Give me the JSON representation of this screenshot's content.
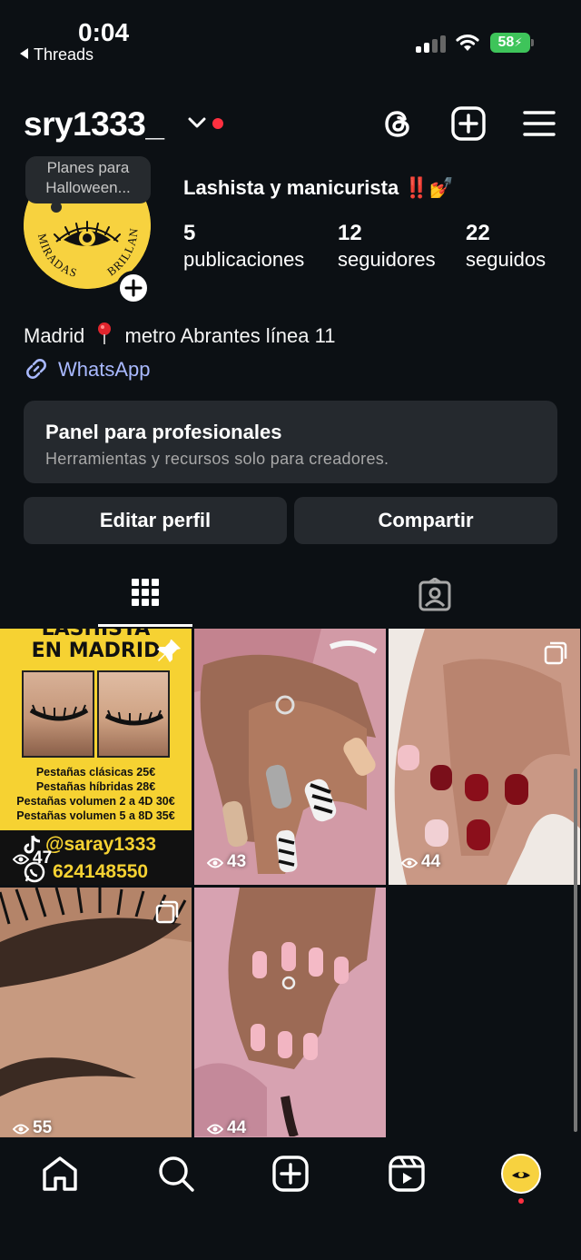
{
  "status_bar": {
    "time": "0:04",
    "back_app": "Threads",
    "battery": "58"
  },
  "header": {
    "username": "sry1333_"
  },
  "profile": {
    "note": "Planes para Halloween...",
    "bio_title": "Lashista y manicurista",
    "bio_emojis": "‼️💅",
    "stats": [
      {
        "value": "5",
        "label": "publicaciones"
      },
      {
        "value": "12",
        "label": "seguidores"
      },
      {
        "value": "22",
        "label": "seguidos"
      }
    ],
    "location_prefix": "Madrid",
    "location_suffix": "metro Abrantes línea 11",
    "link_label": "WhatsApp",
    "avatar_text": "MIRADAS QUE BRILLAN"
  },
  "panel": {
    "title": "Panel para profesionales",
    "subtitle": "Herramientas y recursos solo para creadores."
  },
  "buttons": {
    "edit": "Editar perfil",
    "share": "Compartir"
  },
  "posts": [
    {
      "views": "47",
      "pinned": true,
      "heading": "LASHISTA",
      "heading2": "EN MADRID",
      "prices": [
        "Pestañas clásicas 25€",
        "Pestañas híbridas 28€",
        "Pestañas volumen 2 a 4D 30€",
        "Pestañas volumen 5 a 8D 35€"
      ],
      "handle": "@saray1333",
      "phone": "624148550"
    },
    {
      "views": "43"
    },
    {
      "views": "44",
      "multi": true
    },
    {
      "views": "55",
      "multi": true
    },
    {
      "views": "44"
    }
  ],
  "colors": {
    "background": "#0c1014",
    "card": "#25292e",
    "link": "#a9b9ff",
    "accent_red": "#ff3040",
    "avatar_yellow": "#f7d23f",
    "battery_green": "#3ec45a"
  }
}
